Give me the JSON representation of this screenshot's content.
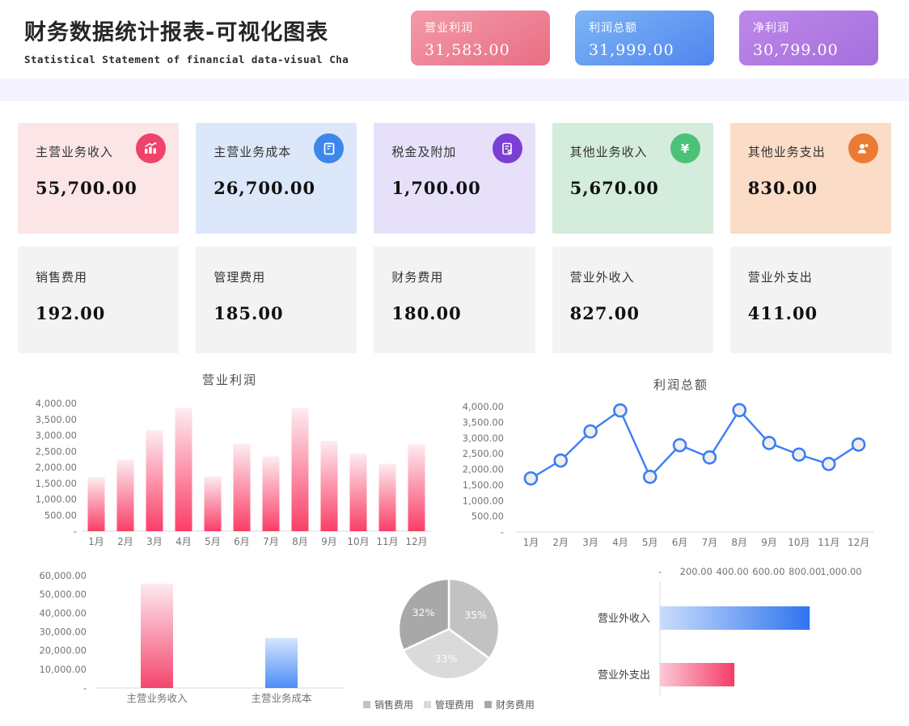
{
  "header": {
    "title": "财务数据统计报表-可视化图表",
    "subtitle": "Statistical Statement of financial data-visual Cha",
    "kpis": [
      {
        "label": "营业利润",
        "value": "31,583.00",
        "gradient": [
          "#f49aa8",
          "#e86e85"
        ]
      },
      {
        "label": "利润总额",
        "value": "31,999.00",
        "gradient": [
          "#7cb5f4",
          "#5185f0"
        ]
      },
      {
        "label": "净利润",
        "value": "30,799.00",
        "gradient": [
          "#bd88e9",
          "#a66fde"
        ]
      }
    ]
  },
  "stat_cards_row1": [
    {
      "label": "主营业务收入",
      "value": "55,700.00",
      "bg": "#fbe5e7",
      "icon": "bar-chart-trend-icon",
      "icon_bg": "#f0436a"
    },
    {
      "label": "主营业务成本",
      "value": "26,700.00",
      "bg": "#dce7f9",
      "icon": "ledger-book-icon",
      "icon_bg": "#3e86ea"
    },
    {
      "label": "税金及附加",
      "value": "1,700.00",
      "bg": "#e7e0f9",
      "icon": "tax-receipt-icon",
      "icon_bg": "#7c3fd4"
    },
    {
      "label": "其他业务收入",
      "value": "5,670.00",
      "bg": "#d4ecdb",
      "icon": "yuan-icon",
      "icon_bg": "#4cc278"
    },
    {
      "label": "其他业务支出",
      "value": "830.00",
      "bg": "#fbdcc6",
      "icon": "people-icon",
      "icon_bg": "#eb7a33"
    }
  ],
  "stat_cards_row2": [
    {
      "label": "销售费用",
      "value": "192.00"
    },
    {
      "label": "管理费用",
      "value": "185.00"
    },
    {
      "label": "财务费用",
      "value": "180.00"
    },
    {
      "label": "营业外收入",
      "value": "827.00"
    },
    {
      "label": "营业外支出",
      "value": "411.00"
    }
  ],
  "chart_data": [
    {
      "id": "operating-profit-bars",
      "type": "bar",
      "title": "营业利润",
      "categories": [
        "1月",
        "2月",
        "3月",
        "4月",
        "5月",
        "6月",
        "7月",
        "8月",
        "9月",
        "10月",
        "11月",
        "12月"
      ],
      "values": [
        1690,
        2230,
        3160,
        3850,
        1715,
        2730,
        2340,
        3850,
        2830,
        2430,
        2110,
        2725
      ],
      "xlabel": "",
      "ylabel": "",
      "ylim": [
        0,
        4000
      ],
      "ytick_step": 500,
      "grid": false,
      "legend": false,
      "bar_gradient": [
        "#fdecf1",
        "#fa3e67"
      ]
    },
    {
      "id": "total-profit-line",
      "type": "line",
      "title": "利润总额",
      "categories": [
        "1月",
        "2月",
        "3月",
        "4月",
        "5月",
        "6月",
        "7月",
        "8月",
        "9月",
        "10月",
        "11月",
        "12月"
      ],
      "values": [
        1710,
        2280,
        3210,
        3880,
        1760,
        2770,
        2380,
        3890,
        2840,
        2470,
        2170,
        2790
      ],
      "xlabel": "",
      "ylabel": "",
      "ylim": [
        0,
        4000
      ],
      "ytick_step": 500,
      "grid": false,
      "legend": false,
      "line_color": "#3d7df5",
      "marker_fill": "#efefef"
    },
    {
      "id": "main-business-columns",
      "type": "bar",
      "title": "",
      "categories": [
        "主营业务收入",
        "主营业务成本"
      ],
      "values": [
        55700,
        26700
      ],
      "xlabel": "",
      "ylabel": "",
      "ylim": [
        0,
        60000
      ],
      "ytick_step": 10000,
      "grid": false,
      "legend": false,
      "bar_gradients": [
        [
          "#fdeaf0",
          "#f4456d"
        ],
        [
          "#d4e6fd",
          "#4b8df5"
        ]
      ]
    },
    {
      "id": "expense-pie",
      "type": "pie",
      "title": "",
      "labels": [
        "销售费用",
        "管理费用",
        "财务费用"
      ],
      "values": [
        35,
        33,
        32
      ],
      "display_labels": [
        "35%",
        "33%",
        "32%"
      ],
      "colors": [
        "#c2c2c2",
        "#dadada",
        "#a8a8a8"
      ],
      "legend_position": "bottom"
    },
    {
      "id": "non-operating-hbar",
      "type": "bar",
      "orientation": "horizontal",
      "title": "",
      "categories": [
        "营业外收入",
        "营业外支出"
      ],
      "values": [
        827,
        411
      ],
      "xlabel": "",
      "ylabel": "",
      "xlim": [
        0,
        1000
      ],
      "xtick_step": 200,
      "grid": false,
      "legend": false,
      "bar_gradients": [
        [
          "#c9ddfb",
          "#2f74ef"
        ],
        [
          "#fbc9d6",
          "#f43d67"
        ]
      ]
    }
  ]
}
